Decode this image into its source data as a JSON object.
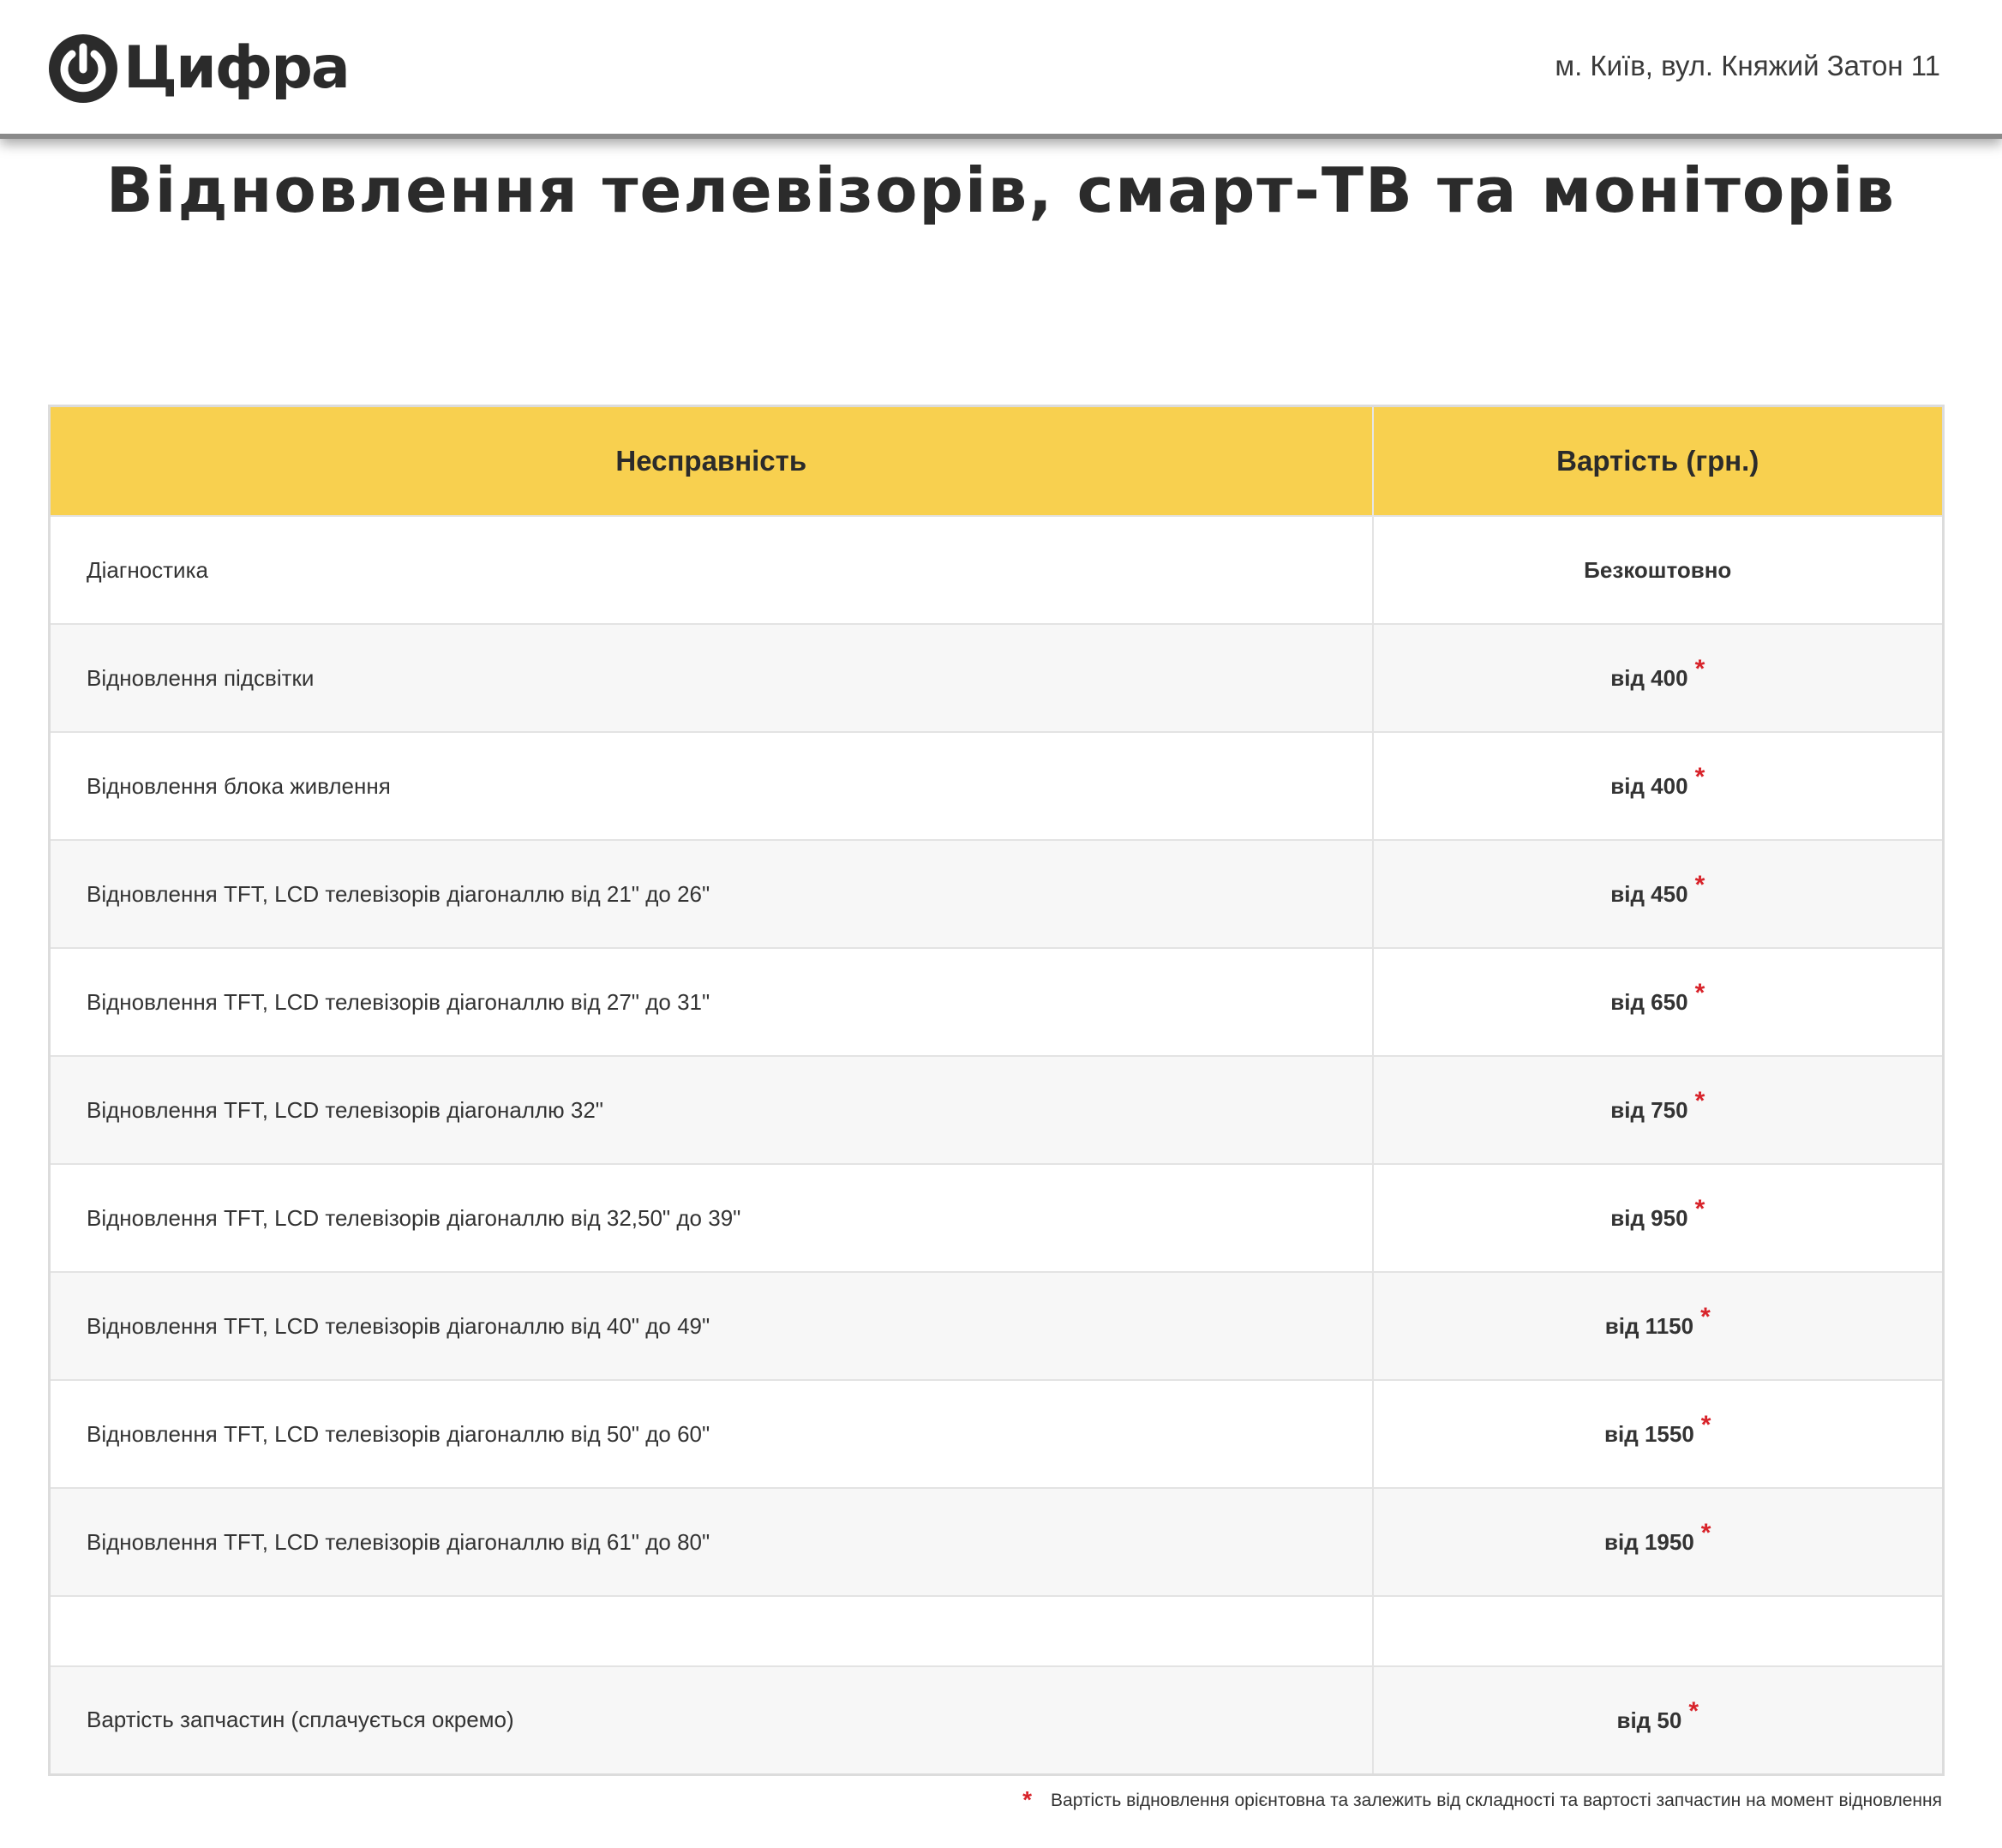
{
  "header": {
    "logo_text": "Цифра",
    "address": "м. Київ, вул. Княжий Затон 11"
  },
  "page_title": "Відновлення телевізорів, смарт-ТВ та моніторів",
  "table": {
    "columns": [
      "Несправність",
      "Вартість (грн.)"
    ],
    "rows": [
      {
        "name": "Діагностика",
        "price": "Безкоштовно",
        "star": ""
      },
      {
        "name": "Відновлення підсвітки",
        "price": "від 400",
        "star": "*"
      },
      {
        "name": "Відновлення блока живлення",
        "price": "від 400",
        "star": "*"
      },
      {
        "name": "Відновлення TFT, LCD телевізорів діагоналлю від 21\" до 26\"",
        "price": "від 450",
        "star": "*"
      },
      {
        "name": "Відновлення TFT, LCD телевізорів діагоналлю від 27\" до 31\"",
        "price": "від 650",
        "star": "*"
      },
      {
        "name": "Відновлення TFT, LCD телевізорів діагоналлю 32\"",
        "price": "від 750",
        "star": "*"
      },
      {
        "name": "Відновлення TFT, LCD телевізорів діагоналлю від 32,50\" до 39\"",
        "price": "від 950",
        "star": "*"
      },
      {
        "name": "Відновлення TFT, LCD телевізорів діагоналлю від 40\" до 49\"",
        "price": "від 1150",
        "star": "*"
      },
      {
        "name": "Відновлення TFT, LCD телевізорів діагоналлю від 50\" до 60\"",
        "price": "від 1550",
        "star": "*"
      },
      {
        "name": "Відновлення TFT, LCD телевізорів діагоналлю від 61\" до 80\"",
        "price": "від 1950",
        "star": "*"
      },
      {
        "name": "",
        "price": "",
        "star": ""
      },
      {
        "name": "Вартість запчастин (сплачується окремо)",
        "price": "від 50",
        "star": "*"
      }
    ]
  },
  "footnote": {
    "star": "*",
    "text": "Вартість відновлення орієнтовна та залежить від складності та вартості запчастин на момент відновлення"
  },
  "colors": {
    "header_bg": "#f8d04f",
    "accent_star": "#d8232a",
    "text": "#2b2b2b"
  },
  "icons": {
    "logo": "power-icon"
  }
}
